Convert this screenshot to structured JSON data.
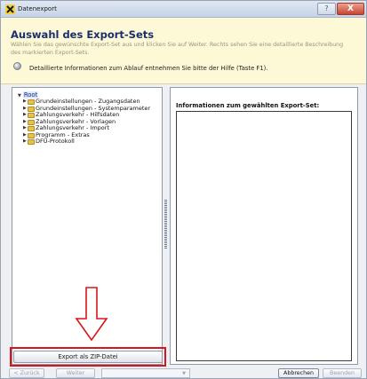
{
  "window": {
    "title": "Datenexport",
    "help_glyph": "?",
    "close_glyph": "X",
    "app_icon": "export-x-icon"
  },
  "header": {
    "heading": "Auswahl des Export-Sets",
    "description": "Wählen Sie das gewünschte Export-Set aus und klicken Sie auf Weiter. Rechts sehen Sie eine detaillierte Beschreibung des markierten Export-Sets.",
    "info_text": "Detaillierte Informationen zum Ablauf entnehmen Sie bitte der Hilfe (Taste F1)."
  },
  "tree": {
    "root_label": "Root",
    "items": [
      {
        "label": "Grundeinstellungen - Zugangsdaten"
      },
      {
        "label": "Grundeinstellungen - Systemparameter"
      },
      {
        "label": "Zahlungsverkehr - Hilfsdaten"
      },
      {
        "label": "Zahlungsverkehr - Vorlagen"
      },
      {
        "label": "Zahlungsverkehr - Import"
      },
      {
        "label": "Programm - Extras"
      },
      {
        "label": "DFÜ-Protokoll"
      }
    ]
  },
  "details": {
    "label": "Informationen zum gewählten Export-Set:"
  },
  "actions": {
    "export_zip": "Export als ZIP-Datei",
    "back": "< Zurück",
    "next": "Weiter",
    "select_value": "",
    "cancel": "Abbrechen",
    "finish": "Beenden"
  },
  "colors": {
    "highlight": "#d8161a",
    "heading": "#1b2f6e",
    "header_bg": "#fdf8d6"
  }
}
